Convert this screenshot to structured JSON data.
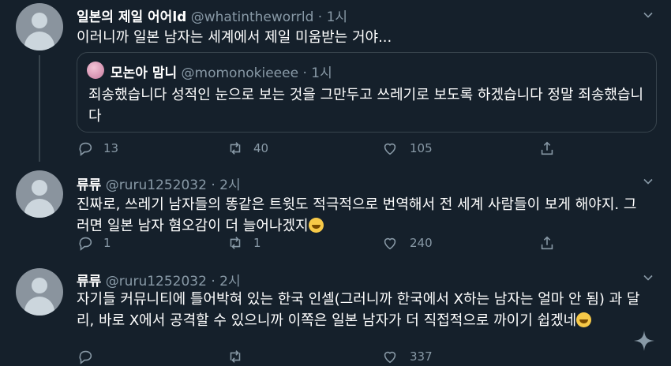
{
  "tweets": [
    {
      "name": "일본의 제일 어어ld",
      "handle": "@whatintheworrld",
      "sep": "·",
      "time": "1시",
      "text": "이러니까 일본 남자는 세계에서 제일 미움받는 거야...",
      "quote": {
        "name": "모논아 맘니",
        "handle": "@momonokieeee",
        "sep": "·",
        "time": "1시",
        "text": "죄송했습니다 성적인 눈으로 보는 것을 그만두고 쓰레기로 보도록 하겠습니다 정말 죄송했습니다"
      },
      "replies": "13",
      "retweets": "40",
      "likes": "105"
    },
    {
      "name": "류류",
      "handle": "@ruru1252032",
      "sep": "·",
      "time": "2시",
      "text": "진짜로, 쓰레기 남자들의 똥같은 트윗도 적극적으로 번역해서 전 세계 사람들이 보게 해야지. 그러면 일본 남자 혐오감이 더 늘어나겠지",
      "replies": "1",
      "retweets": "1",
      "likes": "240"
    },
    {
      "name": "류류",
      "handle": "@ruru1252032",
      "sep": "·",
      "time": "2시",
      "text": "자기들 커뮤니티에 틀어박혀 있는 한국 인셀(그러니까 한국에서 X하는 남자는 얼마 안 됨) 과 달리, 바로 X에서 공격할 수 있으니까 이쪽은 일본 남자가 더 직접적으로 까이기 쉽겠네",
      "replies": "",
      "retweets": "",
      "likes": "337"
    }
  ],
  "icons": {
    "reply": "reply-icon",
    "retweet": "retweet-icon",
    "like": "heart-icon",
    "share": "share-icon",
    "more": "chevron-down-icon",
    "compose": "sparkle-icon"
  },
  "colors": {
    "background": "#15202b",
    "secondary_text": "#8899a6",
    "border": "#38444d"
  }
}
